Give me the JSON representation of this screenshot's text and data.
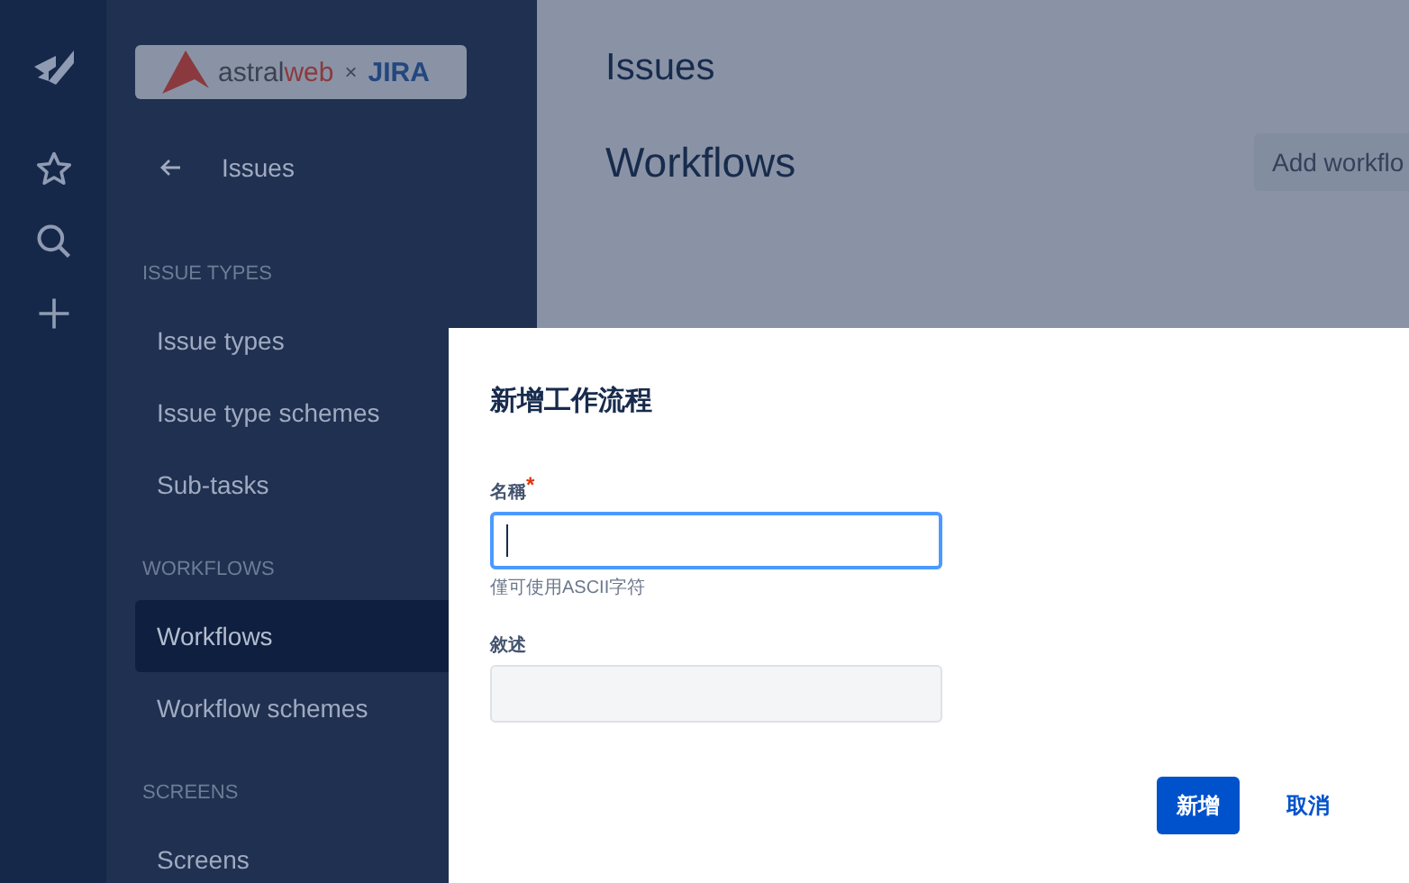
{
  "logo": {
    "name_dark": "astral",
    "name_accent": "web",
    "separator": "×",
    "product": "JIRA"
  },
  "sidebar": {
    "back_label": "Issues",
    "sections": [
      {
        "heading": "ISSUE TYPES",
        "items": [
          {
            "label": "Issue types",
            "selected": false
          },
          {
            "label": "Issue type schemes",
            "selected": false
          },
          {
            "label": "Sub-tasks",
            "selected": false
          }
        ]
      },
      {
        "heading": "WORKFLOWS",
        "items": [
          {
            "label": "Workflows",
            "selected": true
          },
          {
            "label": "Workflow schemes",
            "selected": false
          }
        ]
      },
      {
        "heading": "SCREENS",
        "items": [
          {
            "label": "Screens",
            "selected": false
          }
        ]
      }
    ]
  },
  "main": {
    "breadcrumb": "Issues",
    "title": "Workflows",
    "action_button": "Add workflo"
  },
  "dialog": {
    "title": "新增工作流程",
    "fields": [
      {
        "label": "名稱",
        "required_mark": "*",
        "focused": true,
        "help": "僅可使用ASCII字符"
      },
      {
        "label": "敘述",
        "focused": false
      }
    ],
    "buttons": [
      {
        "label": "新增",
        "kind": "primary"
      },
      {
        "label": "取消",
        "kind": "link"
      }
    ]
  }
}
